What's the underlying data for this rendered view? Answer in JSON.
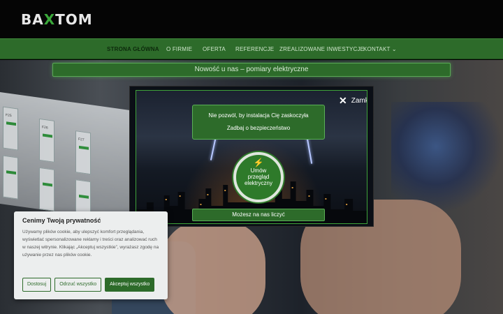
{
  "header": {
    "logo_pre": "BA",
    "logo_x": "X",
    "logo_post": "TOM"
  },
  "nav": {
    "items": [
      {
        "label": "STRONA GŁÓWNA",
        "active": true
      },
      {
        "label": "O FIRMIE"
      },
      {
        "label": "OFERTA"
      },
      {
        "label": "REFERENCJE"
      },
      {
        "label": "ZREALIZOWANE INWESTYCJE"
      },
      {
        "label": "KONTAKT",
        "has_dropdown": true
      }
    ]
  },
  "news_bar": "Nowość u nas – pomiary elektryczne",
  "modal": {
    "close_label": "Zamknij",
    "close_icon": "close-icon",
    "info_line1": "Nie pozwól, by instalacja Cię zaskoczyła",
    "info_line2": "Zadbaj o bezpieczeństwo",
    "cta_line1": "Umów",
    "cta_line2": "przegląd",
    "cta_line3": "elektryczny",
    "trust_label": "Możesz na nas liczyć"
  },
  "hero": {
    "breaker_labels": [
      "F25",
      "F26",
      "F27"
    ]
  },
  "cookie": {
    "title": "Cenimy Twoją prywatność",
    "text": "Używamy plików cookie, aby ulepszyć komfort przeglądania, wyświetlać spersonalizowane reklamy i treści oraz analizować ruch w naszej witrynie. Klikając „Akceptuj wszystkie”, wyrażasz zgodę na używanie przez nas plików cookie.",
    "btn_customize": "Dostosuj",
    "btn_reject": "Odrzuć wszystko",
    "btn_accept": "Akceptuj wszystko"
  },
  "colors": {
    "brand_green": "#2d6b2a",
    "accent_green": "#3aa83a"
  }
}
